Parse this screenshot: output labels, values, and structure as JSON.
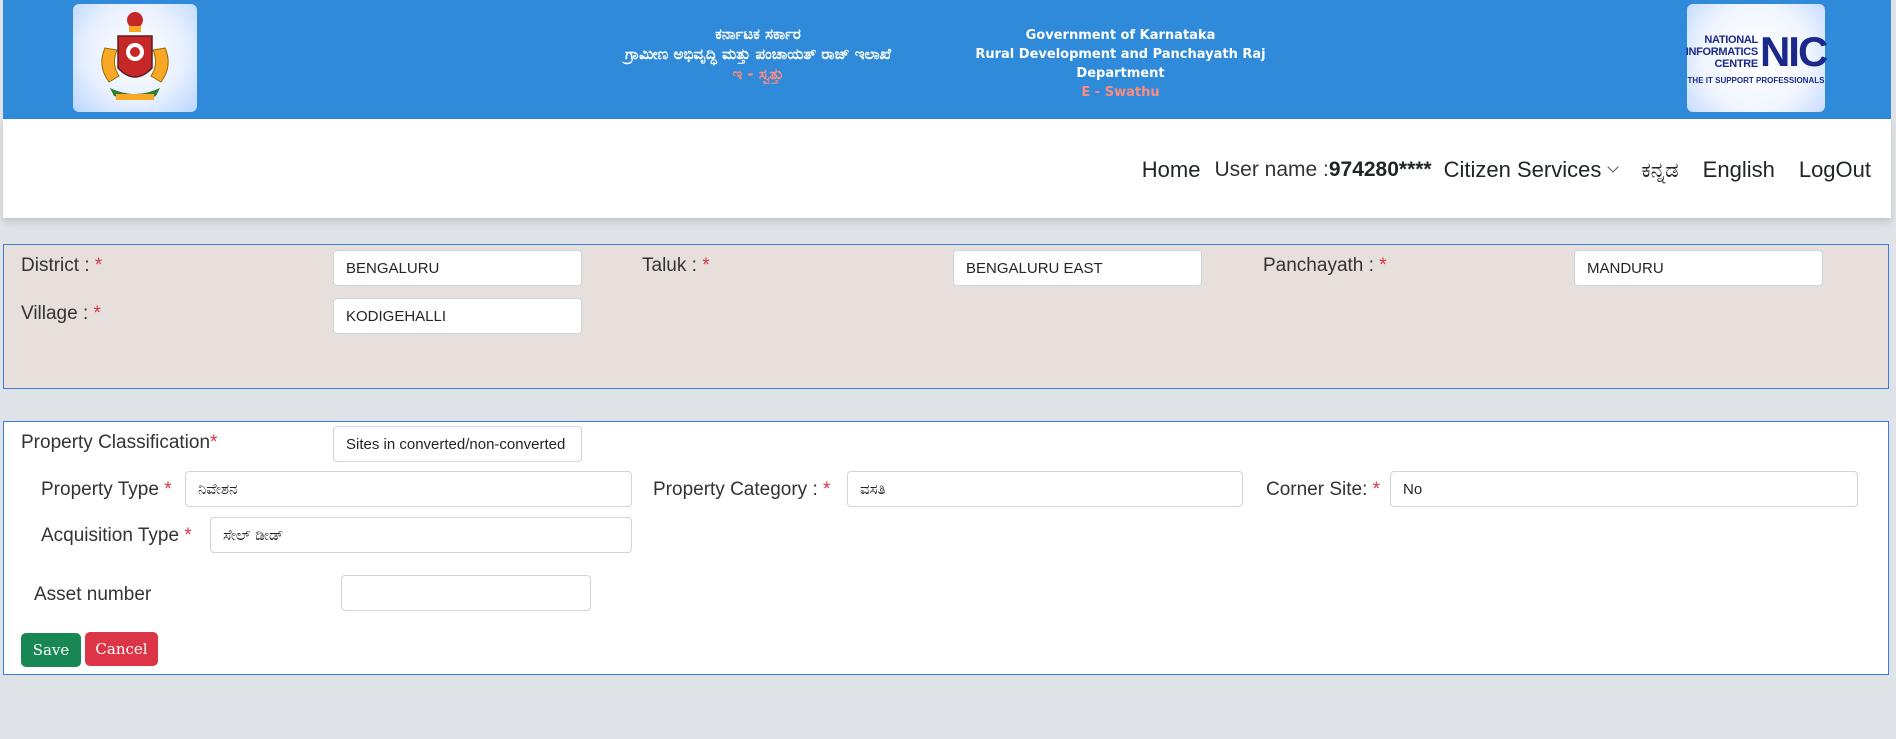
{
  "header": {
    "kn_line1": "ಕರ್ನಾಟಕ ಸರ್ಕಾರ",
    "kn_line2": "ಗ್ರಾಮೀಣ ಅಭಿವೃದ್ಧಿ ಮತ್ತು ಪಂಚಾಯತ್ ರಾಜ್ ಇಲಾಖೆ",
    "kn_line3": "ಇ - ಸ್ವತ್ತು",
    "en_line1": "Government of Karnataka",
    "en_line2": "Rural Development and Panchayath Raj Department",
    "en_line3": "E - Swathu",
    "nic_line1": "NATIONAL",
    "nic_line2": "INFORMATICS",
    "nic_line3": "CENTRE",
    "nic_big": "NIC",
    "nic_tag": "THE IT SUPPORT PROFESSIONALS",
    "accent_color": "#ff8a80",
    "bg_color": "#2f8ad9"
  },
  "nav": {
    "home": "Home",
    "user_label": "User name :",
    "user_value": "974280****",
    "citizen_services": "Citizen Services",
    "kannada": "ಕನ್ನಡ",
    "english": "English",
    "logout": "LogOut"
  },
  "location": {
    "district_label": "District : ",
    "district_value": "BENGALURU",
    "taluk_label": "Taluk : ",
    "taluk_value": "BENGALURU EAST",
    "panchayath_label": "Panchayath : ",
    "panchayath_value": "MANDURU",
    "village_label": "Village : ",
    "village_value": "KODIGEHALLI"
  },
  "property": {
    "classification_label": "Property Classification",
    "classification_value": "Sites in converted/non-converted",
    "type_label": "Property Type ",
    "type_value": "ನಿವೇಶನ",
    "category_label": "Property Category : ",
    "category_value": "ವಸತಿ",
    "corner_label": "Corner Site: ",
    "corner_value": "No",
    "acquisition_label": "Acquisition Type ",
    "acquisition_value": "ಸೇಲ್ ಡೀಡ್",
    "asset_label": "Asset number",
    "asset_value": ""
  },
  "actions": {
    "save": "Save",
    "cancel": "Cancel"
  },
  "required_mark": "*"
}
